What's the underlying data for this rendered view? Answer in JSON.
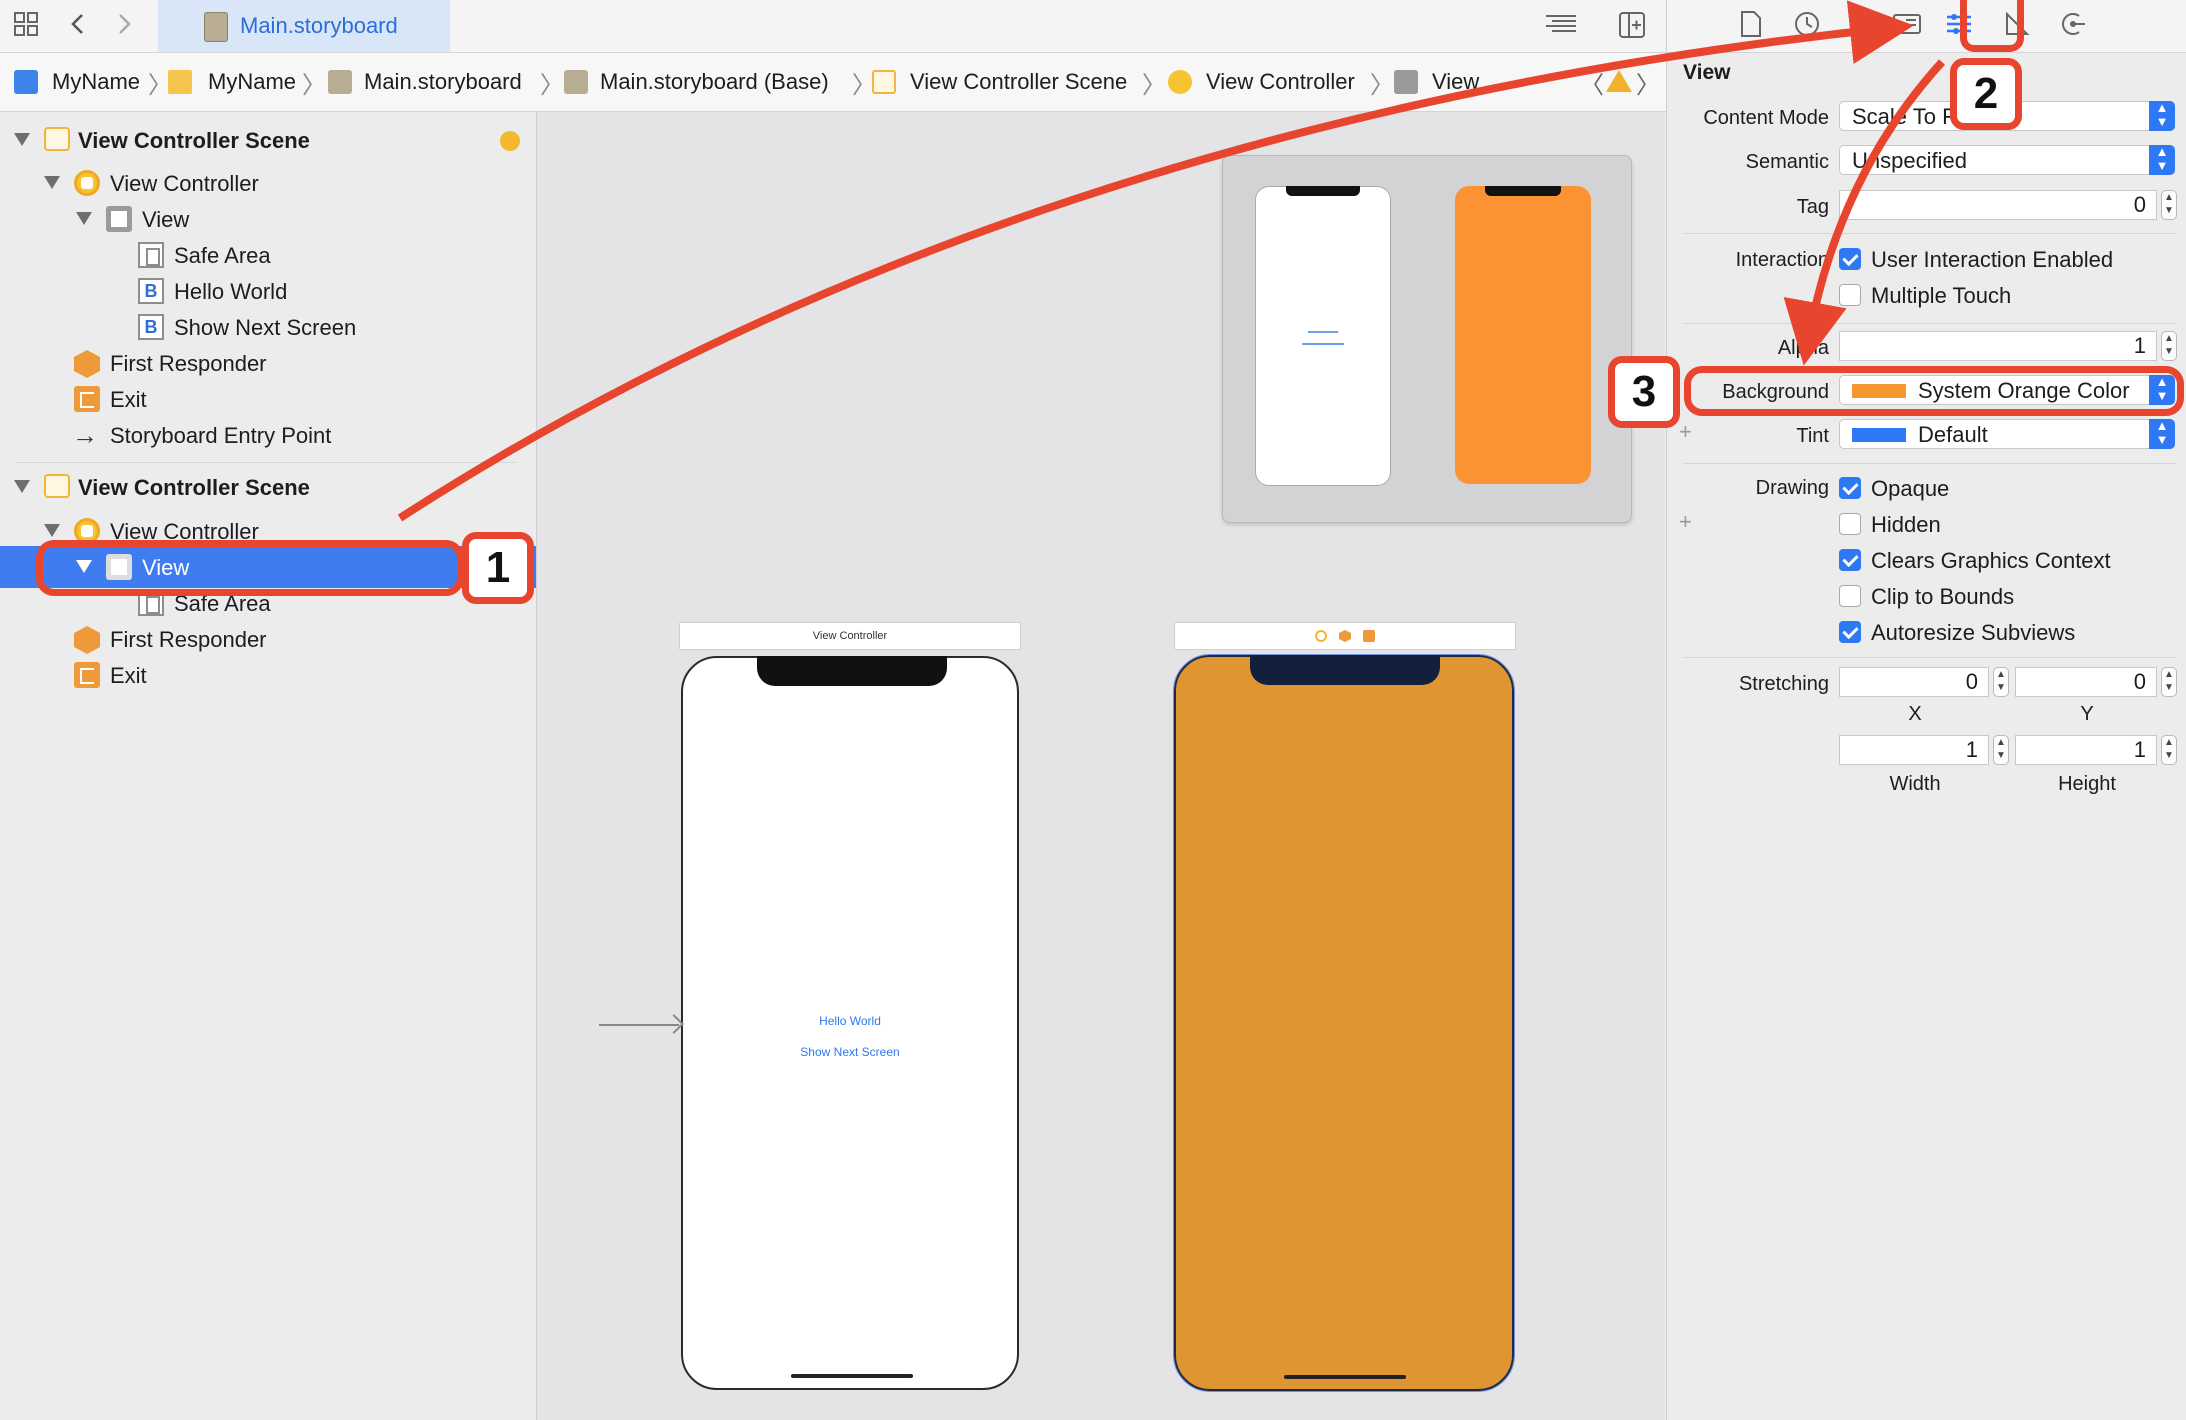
{
  "toolbar": {
    "file_tab": "Main.storyboard"
  },
  "breadcrumb": [
    "MyName",
    "MyName",
    "Main.storyboard",
    "Main.storyboard (Base)",
    "View Controller Scene",
    "View Controller",
    "View"
  ],
  "outline": {
    "scene1": {
      "title": "View Controller Scene",
      "vc": "View Controller",
      "view": "View",
      "safe_area": "Safe Area",
      "hello": "Hello World",
      "show_next": "Show Next Screen",
      "first_responder": "First Responder",
      "exit": "Exit",
      "entry": "Storyboard Entry Point"
    },
    "scene2": {
      "title": "View Controller Scene",
      "vc": "View Controller",
      "view": "View",
      "safe_area": "Safe Area",
      "first_responder": "First Responder",
      "exit": "Exit"
    }
  },
  "canvas": {
    "scene1_title": "View Controller",
    "hello_world": "Hello World",
    "show_next": "Show Next Screen"
  },
  "inspector": {
    "section": "View",
    "content_mode_label": "Content Mode",
    "content_mode_value": "Scale To Fill",
    "semantic_label": "Semantic",
    "semantic_value": "Unspecified",
    "tag_label": "Tag",
    "tag_value": "0",
    "interaction_label": "Interaction",
    "user_interaction": "User Interaction Enabled",
    "multiple_touch": "Multiple Touch",
    "alpha_label": "Alpha",
    "alpha_value": "1",
    "background_label": "Background",
    "background_value": "System Orange Color",
    "tint_label": "Tint",
    "tint_value": "Default",
    "drawing_label": "Drawing",
    "opaque": "Opaque",
    "hidden": "Hidden",
    "clears_graphics": "Clears Graphics Context",
    "clip_bounds": "Clip to Bounds",
    "autoresize": "Autoresize Subviews",
    "stretching_label": "Stretching",
    "stretch_x": "0",
    "stretch_y": "0",
    "stretch_w": "1",
    "stretch_h": "1",
    "x_label": "X",
    "y_label": "Y",
    "width_label": "Width",
    "height_label": "Height"
  },
  "callouts": {
    "one": "1",
    "two": "2",
    "three": "3"
  },
  "colors": {
    "accent": "#2f78f3",
    "orange": "#f7952f",
    "annotation": "#e8452f",
    "tint_default": "#2f78f3"
  }
}
